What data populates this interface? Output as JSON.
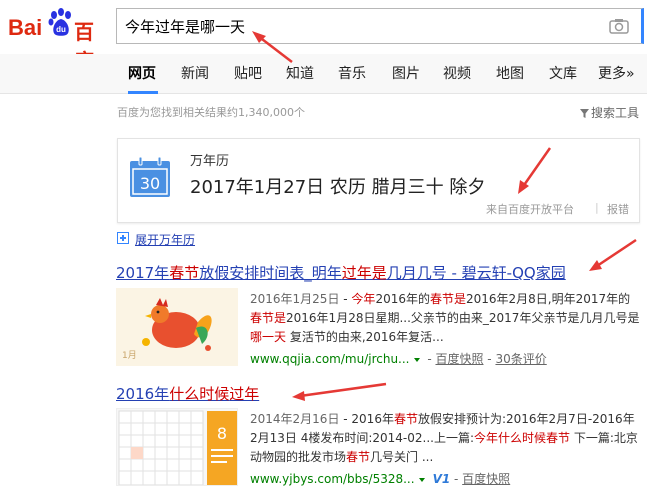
{
  "logo": {
    "bai": "Bai",
    "du": "du",
    "cn": "百度"
  },
  "search": {
    "query": "今年过年是哪一天"
  },
  "nav": {
    "items": [
      "网页",
      "新闻",
      "贴吧",
      "知道",
      "音乐",
      "图片",
      "视频",
      "地图",
      "文库",
      "更多»"
    ]
  },
  "result_count": "百度为您找到相关结果约1,340,000个",
  "search_tools": "搜索工具",
  "calendar_card": {
    "title": "万年历",
    "icon_day": "30",
    "date": "2017年1月27日 农历 腊月三十 除夕",
    "source": "来自百度开放平台",
    "separator": "|",
    "report": "报错"
  },
  "expand": "展开万年历",
  "results": [
    {
      "title_parts": [
        "2017年",
        "春节",
        "放假安排时间表_明年",
        "过年是",
        "几月几号 - 碧云轩-QQ家园"
      ],
      "snippet_date": "2016年1月25日",
      "snippet_parts": [
        " - ",
        "今年",
        "2016年的",
        "春节是",
        "2016年2月8日,明年2017年的",
        "春节是",
        "2016年1月28日星期...父亲节的由来_2017年父亲节是几月几号是",
        "哪一天",
        " 复活节的由来,2016年复活..."
      ],
      "url": "www.qqjia.com/mu/jrchu...",
      "kuaizhao": "百度快照",
      "extra": "30条评价",
      "thumb_text": "1月"
    },
    {
      "title_parts": [
        "2016年",
        "什么时候",
        "过年"
      ],
      "snippet_date": "2014年2月16日",
      "snippet_parts": [
        " - 2016年",
        "春节",
        "放假安排预计为:2016年2月7日-2016年2月13日 4楼发布时间:2014-02...上一篇:",
        "今年什么时候春节",
        " 下一篇:北京动物园的批发市场",
        "春节",
        "几号关门 ..."
      ],
      "url": "www.yjbys.com/bbs/5328...",
      "v1": "V1",
      "kuaizhao": "百度快照",
      "thumb_day": "8"
    }
  ]
}
